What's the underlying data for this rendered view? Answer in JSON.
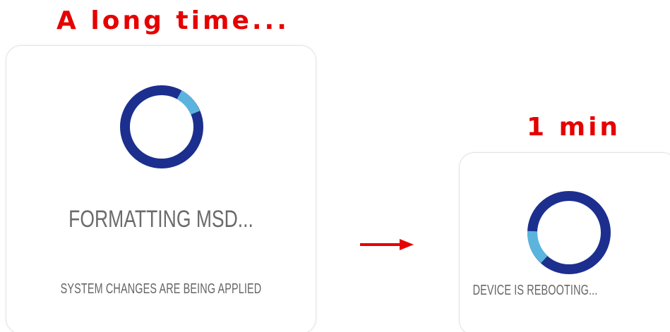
{
  "annotations": {
    "left": "A long time...",
    "right": "1 min"
  },
  "cards": {
    "formatting": {
      "title": "FORMATTING MSD...",
      "subtitle": "SYSTEM CHANGES ARE BEING APPLIED"
    },
    "rebooting": {
      "subtitle": "DEVICE IS REBOOTING..."
    }
  },
  "colors": {
    "annotation": "#e60000",
    "spinner_primary": "#1c2f8f",
    "spinner_accent": "#5bb4dd",
    "text": "#6b6b6b",
    "arrow": "#e60000"
  },
  "icons": {
    "spinner": "loading-spinner-icon",
    "arrow": "arrow-right-icon"
  }
}
